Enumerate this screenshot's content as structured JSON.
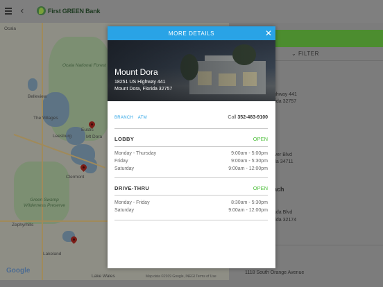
{
  "app": {
    "logo_text": "First GREEN Bank",
    "icons": {
      "menu": "hamburger-icon",
      "back": "back-chevron-icon"
    }
  },
  "map": {
    "labels": [
      "Ocala",
      "Ocala National Forest",
      "Belleview",
      "The Villages",
      "Leesburg",
      "Eustis",
      "Mt Dora",
      "Clermont",
      "Green Swamp Wilderness Preserve",
      "Zephyrhills",
      "Lakeland",
      "Lake Wales"
    ],
    "attribution": "Map data ©2019 Google, INEGI   Terms of Use",
    "google_logo": "Google"
  },
  "list": {
    "filter_label": "FILTER",
    "visible_lines": [
      "ghway 441",
      "rida 32757",
      "wer Blvd",
      "da 34711",
      "ach",
      "ada Blvd",
      "rida 32174",
      "1118 South Orange Avenue"
    ]
  },
  "modal": {
    "title": "MORE DETAILS",
    "branch_name": "Mount Dora",
    "address_line1": "18251 US Highway 441",
    "address_line2": "Mount Dora, Florida 32757",
    "tags": [
      "BRANCH",
      "ATM"
    ],
    "call_label": "Call",
    "phone": "352-483-9100",
    "colors": {
      "accent": "#29a3e6",
      "open": "#4dbf3a",
      "brand_green": "#4c8d2f"
    },
    "sections": [
      {
        "title": "LOBBY",
        "status": "OPEN",
        "hours": [
          {
            "days": "Monday - Thursday",
            "time": "9:00am - 5:00pm"
          },
          {
            "days": "Friday",
            "time": "9:00am - 5:30pm"
          },
          {
            "days": "Saturday",
            "time": "9:00am - 12:00pm"
          }
        ]
      },
      {
        "title": "DRIVE-THRU",
        "status": "OPEN",
        "hours": [
          {
            "days": "Monday - Friday",
            "time": "8:30am - 5:30pm"
          },
          {
            "days": "Saturday",
            "time": "9:00am - 12:00pm"
          }
        ]
      }
    ]
  }
}
